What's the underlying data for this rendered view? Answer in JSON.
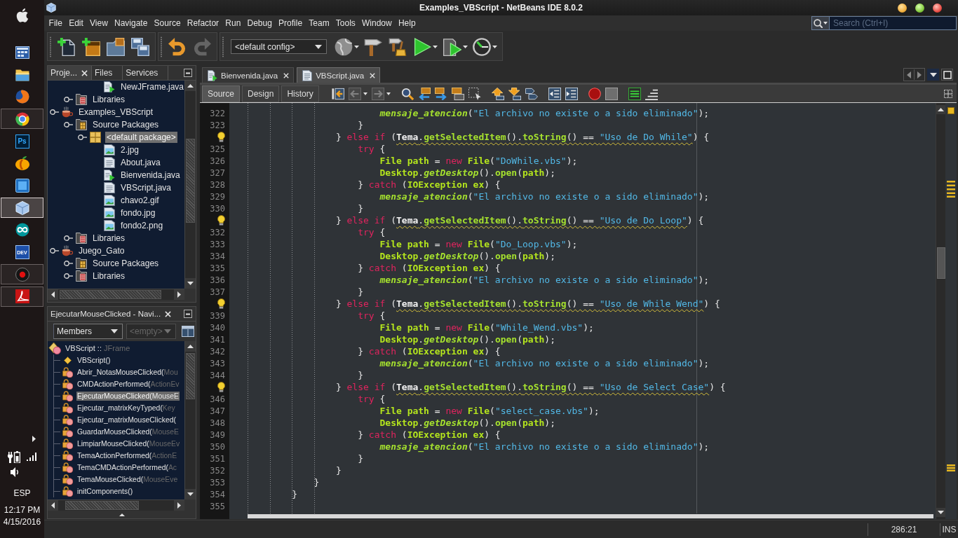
{
  "window": {
    "title": "Examples_VBScript - NetBeans IDE 8.0.2"
  },
  "taskbar": {
    "apps": [
      {
        "kind": "window-grid",
        "running": false,
        "selected": false
      },
      {
        "kind": "folder",
        "running": false,
        "selected": false
      },
      {
        "kind": "fox-globe",
        "running": false,
        "selected": false
      },
      {
        "kind": "pinwheel",
        "running": true,
        "selected": false
      },
      {
        "kind": "ps-tile",
        "label": "Ps",
        "running": false,
        "selected": false
      },
      {
        "kind": "fruit",
        "running": false,
        "selected": false
      },
      {
        "kind": "square-tile",
        "running": false,
        "selected": false
      },
      {
        "kind": "cube",
        "running": true,
        "selected": true
      },
      {
        "kind": "infinity",
        "running": false,
        "selected": false
      },
      {
        "kind": "dev-tile",
        "label": "DEV",
        "running": false,
        "selected": false
      },
      {
        "kind": "disc",
        "running": true,
        "selected": false
      },
      {
        "kind": "swirl-tile",
        "running": true,
        "selected": false
      }
    ],
    "tray": {
      "language": "ESP",
      "time": "12:17 PM",
      "date": "4/15/2016"
    }
  },
  "menu": [
    "File",
    "Edit",
    "View",
    "Navigate",
    "Source",
    "Refactor",
    "Run",
    "Debug",
    "Profile",
    "Team",
    "Tools",
    "Window",
    "Help"
  ],
  "search": {
    "placeholder": "Search (Ctrl+I)"
  },
  "toolbar": {
    "groups": [
      {
        "items": [
          {
            "kind": "new-file",
            "disabled": false,
            "dropdown": false
          },
          {
            "kind": "new-project",
            "disabled": false,
            "dropdown": false
          },
          {
            "kind": "open-project",
            "disabled": false,
            "dropdown": false
          },
          {
            "kind": "save-all",
            "disabled": false,
            "dropdown": false
          }
        ]
      },
      {
        "items": [
          {
            "kind": "undo",
            "disabled": false,
            "dropdown": false
          },
          {
            "kind": "redo",
            "disabled": true,
            "dropdown": false
          }
        ]
      },
      {
        "items": [
          {
            "kind": "config",
            "value": "<default config>"
          },
          {
            "kind": "globe",
            "disabled": false,
            "dropdown": true
          },
          {
            "kind": "hammer",
            "disabled": false,
            "dropdown": false
          },
          {
            "kind": "hammer-broom",
            "disabled": false,
            "dropdown": false
          },
          {
            "kind": "run",
            "disabled": false,
            "dropdown": true
          },
          {
            "kind": "debug",
            "disabled": false,
            "dropdown": true
          },
          {
            "kind": "profile",
            "disabled": false,
            "dropdown": true
          }
        ]
      }
    ]
  },
  "projects_panel": {
    "tabs": [
      {
        "label": "Proje...",
        "selected": true
      },
      {
        "label": "Files",
        "selected": false
      },
      {
        "label": "Services",
        "selected": false
      }
    ],
    "tree": [
      {
        "children": [
          {
            "children": [
              {
                "children": [
                  {
                    "label": "NewJFrame.java",
                    "kind": "runnable",
                    "selected": false
                  }
                ]
              }
            ]
          },
          {
            "label": "Libraries",
            "kind": "libraries",
            "selected": false
          }
        ]
      },
      {
        "label": "Examples_VBScript",
        "kind": "project",
        "selected": false,
        "children": [
          {
            "label": "Source Packages",
            "kind": "sources",
            "selected": false,
            "children": [
              {
                "label": "<default package>",
                "kind": "package",
                "selected": true,
                "children": [
                  {
                    "label": "2.jpg",
                    "kind": "image",
                    "selected": false
                  },
                  {
                    "label": "About.java",
                    "kind": "class",
                    "selected": false
                  },
                  {
                    "label": "Bienvenida.java",
                    "kind": "runnable",
                    "selected": false
                  },
                  {
                    "label": "VBScript.java",
                    "kind": "class",
                    "selected": false
                  },
                  {
                    "label": "chavo2.gif",
                    "kind": "image",
                    "selected": false
                  },
                  {
                    "label": "fondo.jpg",
                    "kind": "image",
                    "selected": false
                  },
                  {
                    "label": "fondo2.png",
                    "kind": "image",
                    "selected": false
                  }
                ]
              }
            ]
          },
          {
            "label": "Libraries",
            "kind": "libraries",
            "selected": false
          }
        ]
      },
      {
        "label": "Juego_Gato",
        "kind": "project",
        "selected": false,
        "children": [
          {
            "label": "Source Packages",
            "kind": "sources",
            "selected": false
          },
          {
            "label": "Libraries",
            "kind": "libraries",
            "selected": false
          }
        ]
      }
    ]
  },
  "navigator": {
    "title": "EjecutarMouseClicked - Navi...",
    "view": {
      "value": "Members"
    },
    "filter": {
      "value": "<empty>",
      "disabled": true
    },
    "root": {
      "name": "VBScript ::",
      "supertype": "JFrame"
    },
    "members": [
      {
        "kind": "constructor",
        "name": "VBScript()",
        "selected": false
      },
      {
        "kind": "private",
        "name": "Abrir_NotasMouseClicked(",
        "params": "Mou",
        "selected": false
      },
      {
        "kind": "private",
        "name": "CMDActionPerformed(",
        "params": "ActionEv",
        "selected": false
      },
      {
        "kind": "private",
        "name": "EjecutarMouseClicked(",
        "params": "MouseE",
        "selected": true
      },
      {
        "kind": "private",
        "name": "Ejecutar_matrixKeyTyped(",
        "params": "Key",
        "selected": false
      },
      {
        "kind": "private",
        "name": "Ejecutar_matrixMouseClicked(",
        "selected": false
      },
      {
        "kind": "private",
        "name": "GuardarMouseClicked(",
        "params": "MouseE",
        "selected": false
      },
      {
        "kind": "private",
        "name": "LimpiarMouseClicked(",
        "params": "MouseEv",
        "selected": false
      },
      {
        "kind": "private",
        "name": "TemaActionPerformed(",
        "params": "ActionE",
        "selected": false
      },
      {
        "kind": "private",
        "name": "TemaCMDActionPerformed(",
        "params": "Ac",
        "selected": false
      },
      {
        "kind": "private",
        "name": "TemaMouseClicked(",
        "params": "MouseEve",
        "selected": false
      },
      {
        "kind": "private",
        "name": "initComponents()",
        "selected": false
      }
    ]
  },
  "editor": {
    "tabs": [
      {
        "label": "Bienvenida.java",
        "kind": "runnable",
        "selected": false
      },
      {
        "label": "VBScript.java",
        "kind": "class",
        "selected": true
      }
    ],
    "views": [
      {
        "label": "Source",
        "selected": true
      },
      {
        "label": "Design",
        "selected": false
      },
      {
        "label": "History",
        "selected": false
      }
    ],
    "toolbar": {
      "groups": [
        {
          "items": [
            {
              "kind": "last-edit",
              "disabled": false,
              "dropdown": false
            },
            {
              "kind": "back",
              "disabled": true,
              "dropdown": true
            },
            {
              "kind": "forward",
              "disabled": true,
              "dropdown": true
            }
          ]
        },
        {
          "items": [
            {
              "kind": "find",
              "disabled": false,
              "dropdown": false
            },
            {
              "kind": "find-previous",
              "disabled": false,
              "dropdown": false
            },
            {
              "kind": "find-next",
              "disabled": false,
              "dropdown": false
            },
            {
              "kind": "highlight",
              "disabled": false,
              "dropdown": false
            },
            {
              "kind": "select-rect",
              "disabled": false,
              "dropdown": false
            }
          ]
        },
        {
          "items": [
            {
              "kind": "bookmark-previous",
              "disabled": false,
              "dropdown": false
            },
            {
              "kind": "bookmark-next",
              "disabled": false,
              "dropdown": false
            },
            {
              "kind": "bookmark-toggle",
              "disabled": false,
              "dropdown": false
            }
          ]
        },
        {
          "items": [
            {
              "kind": "shift-left",
              "disabled": false,
              "dropdown": false
            },
            {
              "kind": "shift-right",
              "disabled": false,
              "dropdown": false
            }
          ]
        },
        {
          "items": [
            {
              "kind": "record",
              "disabled": false,
              "dropdown": false
            },
            {
              "kind": "stop",
              "disabled": false,
              "dropdown": false
            }
          ]
        },
        {
          "items": [
            {
              "kind": "comment",
              "disabled": false,
              "dropdown": false
            },
            {
              "kind": "uncomment",
              "disabled": false,
              "dropdown": false
            }
          ]
        }
      ]
    },
    "lines": [
      {
        "number": "322",
        "hint": false,
        "tokens": [
          {
            "kind": "static-method",
            "text": "                          mensaje_atencion"
          },
          {
            "kind": "plain",
            "text": "("
          },
          {
            "kind": "string",
            "text": "\"El archivo no existe o a sido eliminado\""
          },
          {
            "kind": "plain",
            "text": ");"
          }
        ]
      },
      {
        "number": "323",
        "hint": false,
        "tokens": [
          {
            "kind": "plain",
            "text": "                      }"
          }
        ]
      },
      {
        "hint": true,
        "tokens": [
          {
            "kind": "plain",
            "text": "                  } "
          },
          {
            "kind": "keyword",
            "text": "else if"
          },
          {
            "kind": "plain",
            "text": " ("
          },
          {
            "kind": "flagged",
            "tokens": [
              {
                "kind": "field",
                "text": "Tema"
              },
              {
                "kind": "plain",
                "text": "."
              },
              {
                "kind": "method",
                "text": "getSelectedItem"
              },
              {
                "kind": "plain",
                "text": "()."
              },
              {
                "kind": "method",
                "text": "toString"
              },
              {
                "kind": "plain",
                "text": "() == "
              },
              {
                "kind": "string",
                "text": "\"Uso de Do While\""
              }
            ]
          },
          {
            "kind": "plain",
            "text": ") {"
          }
        ]
      },
      {
        "number": "325",
        "hint": false,
        "tokens": [
          {
            "kind": "keyword",
            "text": "                      try"
          },
          {
            "kind": "plain",
            "text": " {"
          }
        ]
      },
      {
        "number": "326",
        "hint": false,
        "tokens": [
          {
            "kind": "type",
            "text": "                          File"
          },
          {
            "kind": "variable",
            "text": " path"
          },
          {
            "kind": "plain",
            "text": " = "
          },
          {
            "kind": "keyword",
            "text": "new"
          },
          {
            "kind": "type",
            "text": " File"
          },
          {
            "kind": "plain",
            "text": "("
          },
          {
            "kind": "string",
            "text": "\"DoWhile.vbs\""
          },
          {
            "kind": "plain",
            "text": ");"
          }
        ]
      },
      {
        "number": "327",
        "hint": false,
        "tokens": [
          {
            "kind": "type",
            "text": "                          Desktop"
          },
          {
            "kind": "plain",
            "text": "."
          },
          {
            "kind": "static-method",
            "text": "getDesktop"
          },
          {
            "kind": "plain",
            "text": "()."
          },
          {
            "kind": "method",
            "text": "open"
          },
          {
            "kind": "plain",
            "text": "("
          },
          {
            "kind": "variable",
            "text": "path"
          },
          {
            "kind": "plain",
            "text": ");"
          }
        ]
      },
      {
        "number": "328",
        "hint": false,
        "tokens": [
          {
            "kind": "plain",
            "text": "                      } "
          },
          {
            "kind": "keyword",
            "text": "catch"
          },
          {
            "kind": "plain",
            "text": " ("
          },
          {
            "kind": "type",
            "text": "IOException"
          },
          {
            "kind": "variable",
            "text": " ex"
          },
          {
            "kind": "plain",
            "text": ") {"
          }
        ]
      },
      {
        "number": "329",
        "hint": false,
        "tokens": [
          {
            "kind": "static-method",
            "text": "                          mensaje_atencion"
          },
          {
            "kind": "plain",
            "text": "("
          },
          {
            "kind": "string",
            "text": "\"El archivo no existe o a sido eliminado\""
          },
          {
            "kind": "plain",
            "text": ");"
          }
        ]
      },
      {
        "number": "330",
        "hint": false,
        "tokens": [
          {
            "kind": "plain",
            "text": "                      }"
          }
        ]
      },
      {
        "hint": true,
        "tokens": [
          {
            "kind": "plain",
            "text": "                  } "
          },
          {
            "kind": "keyword",
            "text": "else if"
          },
          {
            "kind": "plain",
            "text": " ("
          },
          {
            "kind": "flagged",
            "tokens": [
              {
                "kind": "field",
                "text": "Tema"
              },
              {
                "kind": "plain",
                "text": "."
              },
              {
                "kind": "method",
                "text": "getSelectedItem"
              },
              {
                "kind": "plain",
                "text": "()."
              },
              {
                "kind": "method",
                "text": "toString"
              },
              {
                "kind": "plain",
                "text": "() == "
              },
              {
                "kind": "string",
                "text": "\"Uso de Do Loop\""
              }
            ]
          },
          {
            "kind": "plain",
            "text": ") {"
          }
        ]
      },
      {
        "number": "332",
        "hint": false,
        "tokens": [
          {
            "kind": "keyword",
            "text": "                      try"
          },
          {
            "kind": "plain",
            "text": " {"
          }
        ]
      },
      {
        "number": "333",
        "hint": false,
        "tokens": [
          {
            "kind": "type",
            "text": "                          File"
          },
          {
            "kind": "variable",
            "text": " path"
          },
          {
            "kind": "plain",
            "text": " = "
          },
          {
            "kind": "keyword",
            "text": "new"
          },
          {
            "kind": "type",
            "text": " File"
          },
          {
            "kind": "plain",
            "text": "("
          },
          {
            "kind": "string",
            "text": "\"Do_Loop.vbs\""
          },
          {
            "kind": "plain",
            "text": ");"
          }
        ]
      },
      {
        "number": "334",
        "hint": false,
        "tokens": [
          {
            "kind": "type",
            "text": "                          Desktop"
          },
          {
            "kind": "plain",
            "text": "."
          },
          {
            "kind": "static-method",
            "text": "getDesktop"
          },
          {
            "kind": "plain",
            "text": "()."
          },
          {
            "kind": "method",
            "text": "open"
          },
          {
            "kind": "plain",
            "text": "("
          },
          {
            "kind": "variable",
            "text": "path"
          },
          {
            "kind": "plain",
            "text": ");"
          }
        ]
      },
      {
        "number": "335",
        "hint": false,
        "tokens": [
          {
            "kind": "plain",
            "text": "                      } "
          },
          {
            "kind": "keyword",
            "text": "catch"
          },
          {
            "kind": "plain",
            "text": " ("
          },
          {
            "kind": "type",
            "text": "IOException"
          },
          {
            "kind": "variable",
            "text": " ex"
          },
          {
            "kind": "plain",
            "text": ") {"
          }
        ]
      },
      {
        "number": "336",
        "hint": false,
        "tokens": [
          {
            "kind": "static-method",
            "text": "                          mensaje_atencion"
          },
          {
            "kind": "plain",
            "text": "("
          },
          {
            "kind": "string",
            "text": "\"El archivo no existe o a sido eliminado\""
          },
          {
            "kind": "plain",
            "text": ");"
          }
        ]
      },
      {
        "number": "337",
        "hint": false,
        "tokens": [
          {
            "kind": "plain",
            "text": "                      }"
          }
        ]
      },
      {
        "hint": true,
        "tokens": [
          {
            "kind": "plain",
            "text": "                  } "
          },
          {
            "kind": "keyword",
            "text": "else if"
          },
          {
            "kind": "plain",
            "text": " ("
          },
          {
            "kind": "flagged",
            "tokens": [
              {
                "kind": "field",
                "text": "Tema"
              },
              {
                "kind": "plain",
                "text": "."
              },
              {
                "kind": "method",
                "text": "getSelectedItem"
              },
              {
                "kind": "plain",
                "text": "()."
              },
              {
                "kind": "method",
                "text": "toString"
              },
              {
                "kind": "plain",
                "text": "() == "
              },
              {
                "kind": "string",
                "text": "\"Uso de While Wend\""
              }
            ]
          },
          {
            "kind": "plain",
            "text": ") {"
          }
        ]
      },
      {
        "number": "339",
        "hint": false,
        "tokens": [
          {
            "kind": "keyword",
            "text": "                      try"
          },
          {
            "kind": "plain",
            "text": " {"
          }
        ]
      },
      {
        "number": "340",
        "hint": false,
        "tokens": [
          {
            "kind": "type",
            "text": "                          File"
          },
          {
            "kind": "variable",
            "text": " path"
          },
          {
            "kind": "plain",
            "text": " = "
          },
          {
            "kind": "keyword",
            "text": "new"
          },
          {
            "kind": "type",
            "text": " File"
          },
          {
            "kind": "plain",
            "text": "("
          },
          {
            "kind": "string",
            "text": "\"While_Wend.vbs\""
          },
          {
            "kind": "plain",
            "text": ");"
          }
        ]
      },
      {
        "number": "341",
        "hint": false,
        "tokens": [
          {
            "kind": "type",
            "text": "                          Desktop"
          },
          {
            "kind": "plain",
            "text": "."
          },
          {
            "kind": "static-method",
            "text": "getDesktop"
          },
          {
            "kind": "plain",
            "text": "()."
          },
          {
            "kind": "method",
            "text": "open"
          },
          {
            "kind": "plain",
            "text": "("
          },
          {
            "kind": "variable",
            "text": "path"
          },
          {
            "kind": "plain",
            "text": ");"
          }
        ]
      },
      {
        "number": "342",
        "hint": false,
        "tokens": [
          {
            "kind": "plain",
            "text": "                      } "
          },
          {
            "kind": "keyword",
            "text": "catch"
          },
          {
            "kind": "plain",
            "text": " ("
          },
          {
            "kind": "type",
            "text": "IOException"
          },
          {
            "kind": "variable",
            "text": " ex"
          },
          {
            "kind": "plain",
            "text": ") {"
          }
        ]
      },
      {
        "number": "343",
        "hint": false,
        "tokens": [
          {
            "kind": "static-method",
            "text": "                          mensaje_atencion"
          },
          {
            "kind": "plain",
            "text": "("
          },
          {
            "kind": "string",
            "text": "\"El archivo no existe o a sido eliminado\""
          },
          {
            "kind": "plain",
            "text": ");"
          }
        ]
      },
      {
        "number": "344",
        "hint": false,
        "tokens": [
          {
            "kind": "plain",
            "text": "                      }"
          }
        ]
      },
      {
        "hint": true,
        "tokens": [
          {
            "kind": "plain",
            "text": "                  } "
          },
          {
            "kind": "keyword",
            "text": "else if"
          },
          {
            "kind": "plain",
            "text": " ("
          },
          {
            "kind": "flagged",
            "tokens": [
              {
                "kind": "field",
                "text": "Tema"
              },
              {
                "kind": "plain",
                "text": "."
              },
              {
                "kind": "method",
                "text": "getSelectedItem"
              },
              {
                "kind": "plain",
                "text": "()."
              },
              {
                "kind": "method",
                "text": "toString"
              },
              {
                "kind": "plain",
                "text": "() == "
              },
              {
                "kind": "string",
                "text": "\"Uso de Select Case\""
              }
            ]
          },
          {
            "kind": "plain",
            "text": ") {"
          }
        ]
      },
      {
        "number": "346",
        "hint": false,
        "tokens": [
          {
            "kind": "keyword",
            "text": "                      try"
          },
          {
            "kind": "plain",
            "text": " {"
          }
        ]
      },
      {
        "number": "347",
        "hint": false,
        "tokens": [
          {
            "kind": "type",
            "text": "                          File"
          },
          {
            "kind": "variable",
            "text": " path"
          },
          {
            "kind": "plain",
            "text": " = "
          },
          {
            "kind": "keyword",
            "text": "new"
          },
          {
            "kind": "type",
            "text": " File"
          },
          {
            "kind": "plain",
            "text": "("
          },
          {
            "kind": "string",
            "text": "\"select_case.vbs\""
          },
          {
            "kind": "plain",
            "text": ");"
          }
        ]
      },
      {
        "number": "348",
        "hint": false,
        "tokens": [
          {
            "kind": "type",
            "text": "                          Desktop"
          },
          {
            "kind": "plain",
            "text": "."
          },
          {
            "kind": "static-method",
            "text": "getDesktop"
          },
          {
            "kind": "plain",
            "text": "()."
          },
          {
            "kind": "method",
            "text": "open"
          },
          {
            "kind": "plain",
            "text": "("
          },
          {
            "kind": "variable",
            "text": "path"
          },
          {
            "kind": "plain",
            "text": ");"
          }
        ]
      },
      {
        "number": "349",
        "hint": false,
        "tokens": [
          {
            "kind": "plain",
            "text": "                      } "
          },
          {
            "kind": "keyword",
            "text": "catch"
          },
          {
            "kind": "plain",
            "text": " ("
          },
          {
            "kind": "type",
            "text": "IOException"
          },
          {
            "kind": "variable",
            "text": " ex"
          },
          {
            "kind": "plain",
            "text": ") {"
          }
        ]
      },
      {
        "number": "350",
        "hint": false,
        "tokens": [
          {
            "kind": "static-method",
            "text": "                          mensaje_atencion"
          },
          {
            "kind": "plain",
            "text": "("
          },
          {
            "kind": "string",
            "text": "\"El archivo no existe o a sido eliminado\""
          },
          {
            "kind": "plain",
            "text": ");"
          }
        ]
      },
      {
        "number": "351",
        "hint": false,
        "tokens": [
          {
            "kind": "plain",
            "text": "                      }"
          }
        ]
      },
      {
        "number": "352",
        "hint": false,
        "tokens": [
          {
            "kind": "plain",
            "text": "                  }"
          }
        ]
      },
      {
        "number": "353",
        "hint": false,
        "tokens": [
          {
            "kind": "plain",
            "text": "              }"
          }
        ]
      },
      {
        "number": "354",
        "hint": false,
        "tokens": [
          {
            "kind": "plain",
            "text": "          }"
          }
        ]
      },
      {
        "number": "355",
        "hint": false
      }
    ]
  },
  "status_bar": {
    "position": "286:21",
    "mode": "INS"
  }
}
